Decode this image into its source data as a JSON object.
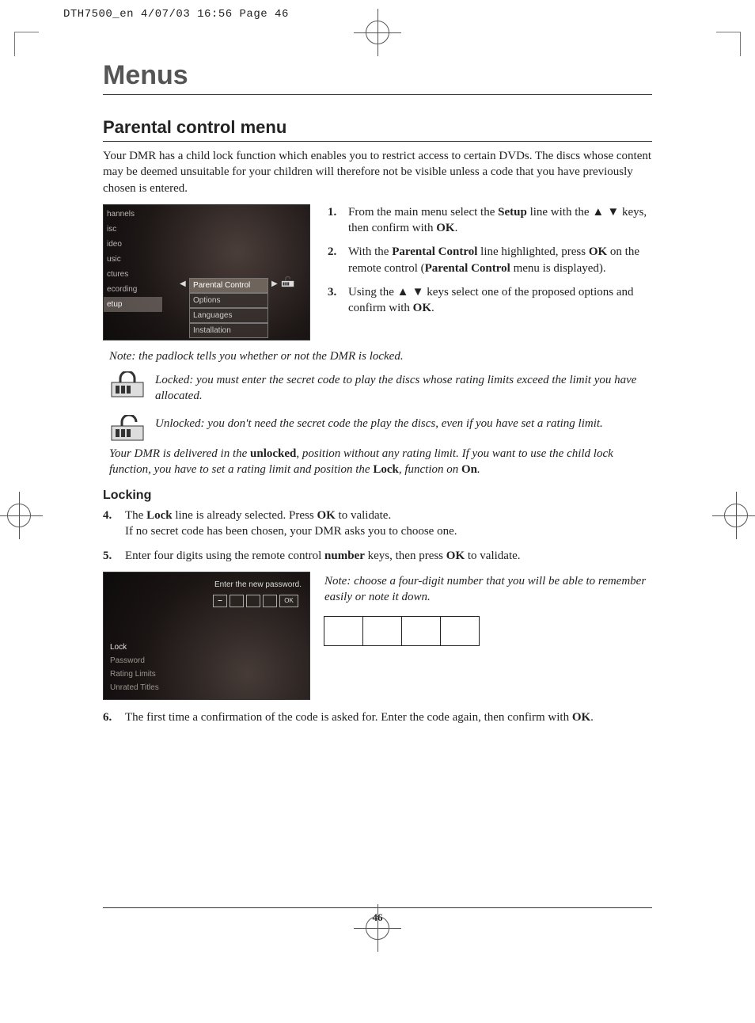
{
  "doc_header": "DTH7500_en  4/07/03  16:56  Page 46",
  "chapter": "Menus",
  "section": "Parental control menu",
  "intro": "Your DMR has a child lock function which enables you to restrict access to certain DVDs. The discs whose content may be deemed unsuitable for your children will therefore not be visible unless a code that you have previously chosen is entered.",
  "shot1": {
    "left": [
      "hannels",
      "isc",
      "ideo",
      "usic",
      "ctures",
      "ecording",
      "etup"
    ],
    "left_hi_index": 6,
    "sub": [
      "Parental Control",
      "Options",
      "Languages",
      "Installation"
    ],
    "sub_hi_index": 0
  },
  "steps_a": [
    {
      "n": "1.",
      "pre": "From the main menu select the ",
      "b1": "Setup",
      "mid": " line with the ",
      "arrows": "▲ ▼",
      "post": " keys, then confirm with ",
      "b2": "OK",
      "end": "."
    },
    {
      "n": "2.",
      "pre": "With the ",
      "b1": "Parental Control",
      "mid": " line highlighted, press ",
      "b2": "OK",
      "mid2": " on the remote control (",
      "b3": "Parental Control",
      "post": " menu is displayed)."
    },
    {
      "n": "3.",
      "pre": "Using the ",
      "arrows": "▲ ▼",
      "mid": " keys select one of the proposed options and confirm with ",
      "b1": "OK",
      "end": "."
    }
  ],
  "note_padlock": "Note: the padlock tells you whether or not the DMR is locked.",
  "note_locked": "Locked: you must enter the secret code to play the discs whose rating limits exceed the limit you have allocated.",
  "note_unlocked": "Unlocked: you don't need the secret code the play the discs, even if you have set a rating limit.",
  "note_delivered_pre": "Your DMR is delivered in the ",
  "note_delivered_b1": "unlocked",
  "note_delivered_mid": ", position without any rating limit. If you want to use the child lock function, you have to set a rating limit and position the ",
  "note_delivered_b2": "Lock",
  "note_delivered_mid2": ", function on ",
  "note_delivered_b3": "On",
  "note_delivered_end": ".",
  "locking_title": "Locking",
  "steps_b": [
    {
      "n": "4.",
      "pre": "The ",
      "b1": "Lock",
      "mid": " line is already selected. Press ",
      "b2": "OK",
      "post": " to validate.",
      "line2": "If no secret code has been chosen, your DMR asks you to choose one."
    },
    {
      "n": "5.",
      "pre": "Enter four digits using the remote control ",
      "b1": "number",
      "mid": " keys, then press ",
      "b2": "OK",
      "post": " to validate."
    }
  ],
  "shot2": {
    "pw_label": "Enter the new password.",
    "ok": "OK",
    "list": [
      "Lock",
      "Password",
      "Rating Limits",
      "Unrated Titles"
    ],
    "hi_index": 0
  },
  "note_choose": "Note: choose a four-digit number that you will be able to remember easily or note it down.",
  "step6": {
    "n": "6.",
    "pre": "The first time a confirmation of the code is asked for. Enter the code again, then confirm with ",
    "b1": "OK",
    "end": "."
  },
  "page_number": "46"
}
